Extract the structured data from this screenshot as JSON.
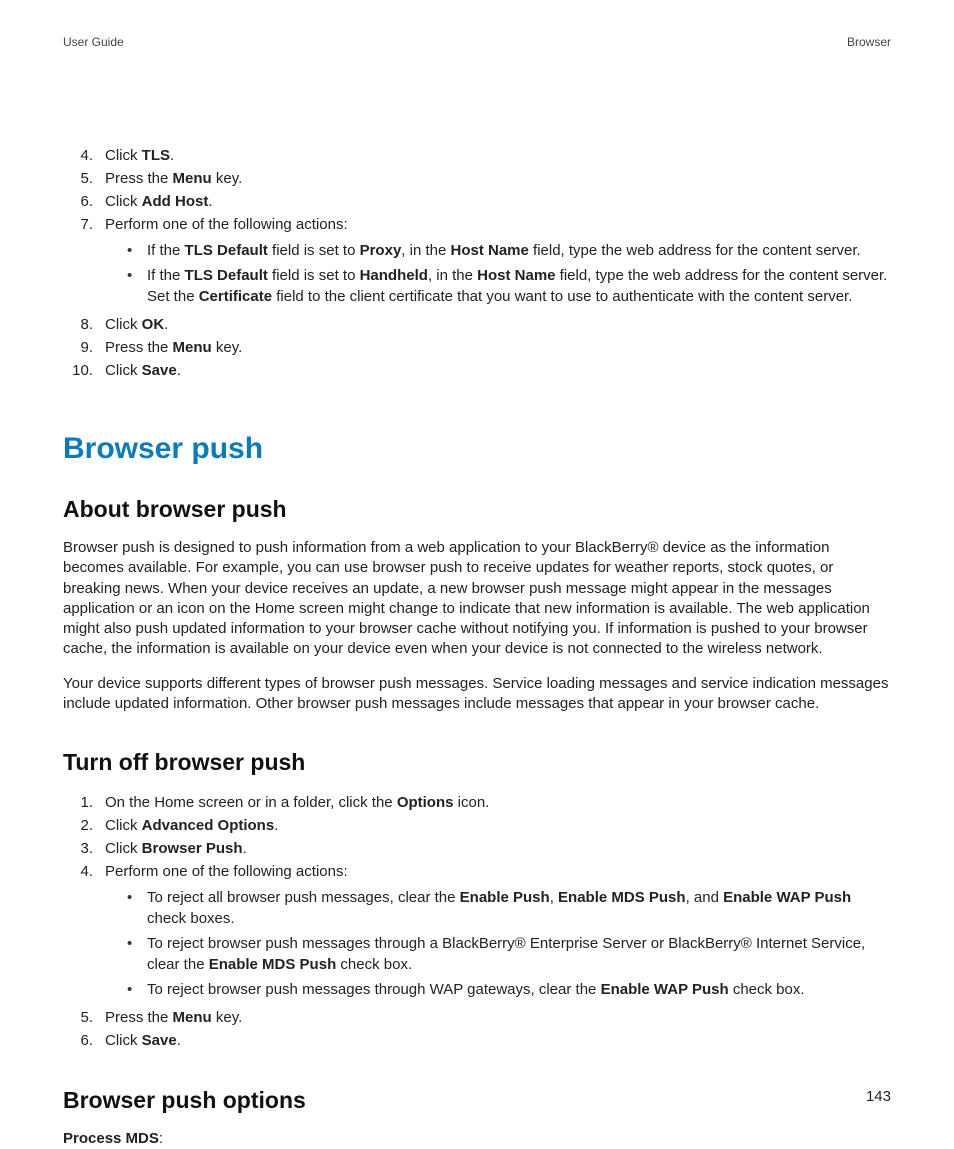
{
  "header": {
    "left": "User Guide",
    "right": "Browser"
  },
  "steps1": {
    "items": [
      {
        "n": "4.",
        "runs": [
          [
            "Click ",
            0
          ],
          [
            "TLS",
            1
          ],
          [
            ".",
            0
          ]
        ]
      },
      {
        "n": "5.",
        "runs": [
          [
            "Press the ",
            0
          ],
          [
            "Menu",
            1
          ],
          [
            " key.",
            0
          ]
        ]
      },
      {
        "n": "6.",
        "runs": [
          [
            "Click ",
            0
          ],
          [
            "Add Host",
            1
          ],
          [
            ".",
            0
          ]
        ]
      },
      {
        "n": "7.",
        "runs": [
          [
            "Perform one of the following actions:",
            0
          ]
        ],
        "sub": [
          [
            [
              "If the ",
              0
            ],
            [
              "TLS Default",
              1
            ],
            [
              " field is set to ",
              0
            ],
            [
              "Proxy",
              1
            ],
            [
              ", in the ",
              0
            ],
            [
              "Host Name",
              1
            ],
            [
              " field, type the web address for the content server.",
              0
            ]
          ],
          [
            [
              "If the ",
              0
            ],
            [
              "TLS Default",
              1
            ],
            [
              " field is set to ",
              0
            ],
            [
              "Handheld",
              1
            ],
            [
              ", in the ",
              0
            ],
            [
              "Host Name",
              1
            ],
            [
              " field, type the web address for the content server. Set the ",
              0
            ],
            [
              "Certificate",
              1
            ],
            [
              " field to the client certificate that you want to use to authenticate with the content server.",
              0
            ]
          ]
        ]
      },
      {
        "n": "8.",
        "runs": [
          [
            "Click ",
            0
          ],
          [
            "OK",
            1
          ],
          [
            ".",
            0
          ]
        ]
      },
      {
        "n": "9.",
        "runs": [
          [
            "Press the ",
            0
          ],
          [
            "Menu",
            1
          ],
          [
            " key.",
            0
          ]
        ]
      },
      {
        "n": "10.",
        "runs": [
          [
            "Click ",
            0
          ],
          [
            "Save",
            1
          ],
          [
            ".",
            0
          ]
        ]
      }
    ]
  },
  "section": {
    "title": "Browser push"
  },
  "about": {
    "title": "About browser push",
    "p1": "Browser push is designed to push information from a web application to your BlackBerry® device as the information becomes available. For example, you can use browser push to receive updates for weather reports, stock quotes, or breaking news. When your device receives an update, a new browser push message might appear in the messages application or an icon on the Home screen might change to indicate that new information is available. The web application might also push updated information to your browser cache without notifying you. If information is pushed to your browser cache, the information is available on your device even when your device is not connected to the wireless network.",
    "p2": "Your device supports different types of browser push messages. Service loading messages and service indication messages include updated information. Other browser push messages include messages that appear in your browser cache."
  },
  "turnoff": {
    "title": "Turn off browser push",
    "items": [
      {
        "n": "1.",
        "runs": [
          [
            "On the Home screen or in a folder, click the ",
            0
          ],
          [
            "Options",
            1
          ],
          [
            " icon.",
            0
          ]
        ]
      },
      {
        "n": "2.",
        "runs": [
          [
            "Click ",
            0
          ],
          [
            "Advanced Options",
            1
          ],
          [
            ".",
            0
          ]
        ]
      },
      {
        "n": "3.",
        "runs": [
          [
            "Click ",
            0
          ],
          [
            "Browser Push",
            1
          ],
          [
            ".",
            0
          ]
        ]
      },
      {
        "n": "4.",
        "runs": [
          [
            "Perform one of the following actions:",
            0
          ]
        ],
        "sub": [
          [
            [
              "To reject all browser push messages, clear the ",
              0
            ],
            [
              "Enable Push",
              1
            ],
            [
              ", ",
              0
            ],
            [
              "Enable MDS Push",
              1
            ],
            [
              ", and ",
              0
            ],
            [
              "Enable WAP Push",
              1
            ],
            [
              " check boxes.",
              0
            ]
          ],
          [
            [
              "To reject browser push messages through a BlackBerry® Enterprise Server or BlackBerry® Internet Service, clear the ",
              0
            ],
            [
              "Enable MDS Push",
              1
            ],
            [
              " check box.",
              0
            ]
          ],
          [
            [
              "To reject browser push messages through WAP gateways, clear the ",
              0
            ],
            [
              "Enable WAP Push",
              1
            ],
            [
              " check box.",
              0
            ]
          ]
        ]
      },
      {
        "n": "5.",
        "runs": [
          [
            "Press the ",
            0
          ],
          [
            "Menu",
            1
          ],
          [
            " key.",
            0
          ]
        ]
      },
      {
        "n": "6.",
        "runs": [
          [
            "Click ",
            0
          ],
          [
            "Save",
            1
          ],
          [
            ".",
            0
          ]
        ]
      }
    ]
  },
  "options": {
    "title": "Browser push options",
    "p1runs": [
      [
        "Process MDS",
        1
      ],
      [
        ":",
        0
      ]
    ]
  },
  "footer": {
    "page": "143"
  }
}
